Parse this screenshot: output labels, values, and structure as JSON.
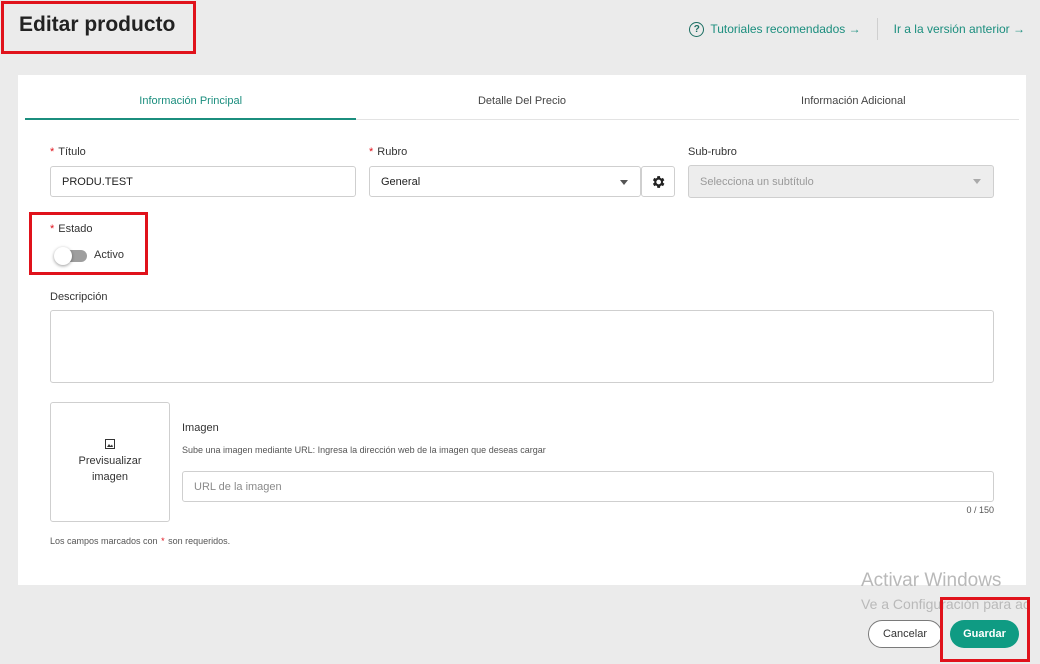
{
  "header": {
    "title": "Editar producto",
    "tutorials_link": "Tutoriales recomendados →",
    "previous_version_link": "Ir a la versión anterior →"
  },
  "tabs": [
    {
      "label": "Información Principal",
      "active": true
    },
    {
      "label": "Detalle Del Precio",
      "active": false
    },
    {
      "label": "Información Adicional",
      "active": false
    }
  ],
  "form": {
    "required_mark": "*",
    "titulo": {
      "label": "Título",
      "value": "PRODU.TEST"
    },
    "rubro": {
      "label": "Rubro",
      "value": "General"
    },
    "subrubro": {
      "label": "Sub-rubro",
      "placeholder": "Selecciona un subtítulo"
    },
    "estado": {
      "label": "Estado",
      "toggle_label": "Activo"
    },
    "descripcion": {
      "label": "Descripción",
      "value": ""
    },
    "imagen": {
      "preview_label": "Previsualizar imagen",
      "label": "Imagen",
      "help": "Sube una imagen mediante URL: Ingresa la dirección web de la imagen que deseas cargar",
      "placeholder": "URL de la imagen",
      "counter": "0 / 150"
    },
    "required_note_before": "Los campos marcados con",
    "required_note_after": "son requeridos."
  },
  "watermark": {
    "title": "Activar Windows",
    "subtitle": "Ve a Configuración para ac"
  },
  "actions": {
    "cancel": "Cancelar",
    "save": "Guardar"
  },
  "colors": {
    "accent": "#1b8e7e",
    "primary_button": "#0f9b83",
    "highlight": "#e0121b"
  },
  "icons": [
    "help-icon",
    "gear-icon",
    "image-icon",
    "chevron-down-icon"
  ]
}
